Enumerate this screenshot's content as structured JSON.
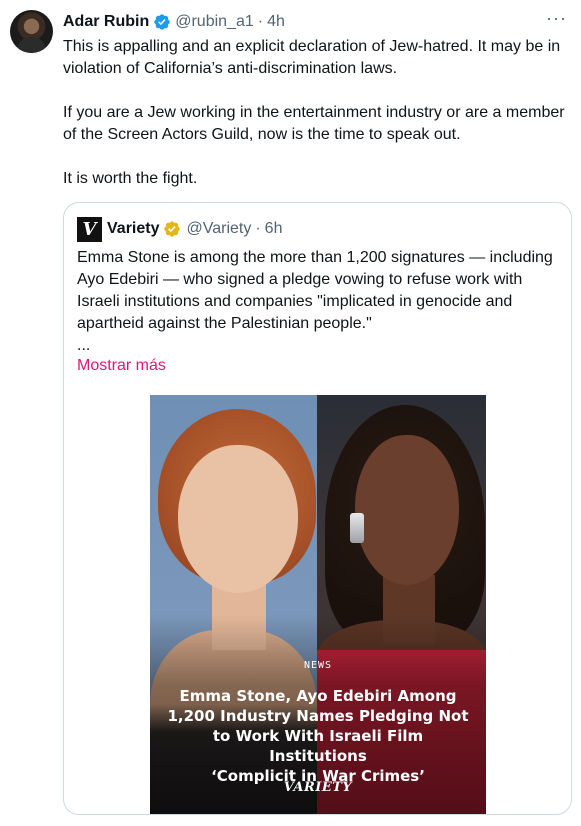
{
  "author": {
    "name": "Adar Rubin",
    "handle": "@rubin_a1",
    "separator": "·",
    "time": "4h",
    "more_label": "···"
  },
  "body": {
    "paragraphs": [
      "This is appalling and an explicit declaration of Jew-hatred. It may be in violation of California’s anti-discrimination laws.",
      "If you are a Jew working in the entertainment industry or are a member of the Screen Actors Guild, now is the time to speak out.",
      "It is worth the fight."
    ]
  },
  "quote": {
    "logo_letter": "V",
    "name": "Variety",
    "handle": "@Variety",
    "separator": "·",
    "time": "6h",
    "text": "Emma Stone is among the more than 1,200 signatures — including Ayo Edebiri — who signed a pledge vowing to refuse work with Israeli institutions and companies \"implicated in genocide and apartheid against the Palestinian people.\"",
    "ellipsis": "...",
    "show_more": "Mostrar más",
    "media": {
      "kicker": "NEWS",
      "headline": "Emma Stone, Ayo Edebiri Among\n1,200 Industry Names Pledging Not\nto Work With Israeli Film Institutions\n‘Complicit in War Crimes’",
      "wordmark": "VARIETY"
    }
  },
  "colors": {
    "verified_blue": "#1d9bf0",
    "gold_badge": "#e2b719",
    "link_pink": "#e0157a",
    "secondary_text": "#536471",
    "border": "#cfd9de"
  }
}
